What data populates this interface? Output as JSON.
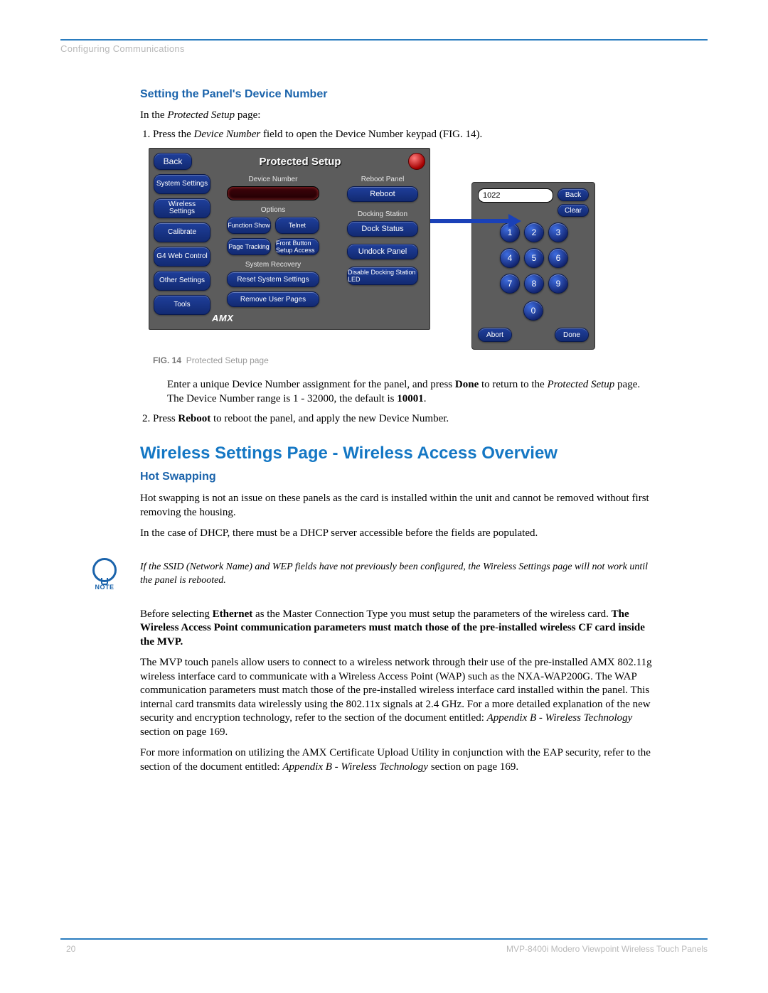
{
  "chapter_head": "Configuring Communications",
  "section_heading": "Setting the Panel's Device Number",
  "intro": {
    "prefix": "In the ",
    "em": "Protected Setup",
    "suffix": " page:"
  },
  "steps": {
    "s1": {
      "prefix": "Press the ",
      "em": "Device Number",
      "suffix": " field to open the Device Number keypad (FIG. 14)."
    },
    "s2": {
      "t1": "Enter a unique Device Number assignment for the panel",
      "comma": ",",
      "t2": " and press ",
      "bold1": "Done",
      "t3": " to return to the ",
      "em": "Protected Setup",
      "t4": " page. The Device Number range is 1 - 32000, the default is ",
      "bold2": "10001",
      "t5": "."
    },
    "s3": {
      "t1": "Press ",
      "bold": "Reboot",
      "t2": " to reboot the panel, and apply the new Device Number."
    }
  },
  "fig": {
    "label": "FIG. 14",
    "caption": "Protected Setup page"
  },
  "panel": {
    "back": "Back",
    "title": "Protected Setup",
    "side": [
      "System Settings",
      "Wireless Settings",
      "Calibrate",
      "G4 Web Control",
      "Other Settings",
      "Tools"
    ],
    "center": {
      "device_number_label": "Device Number",
      "options_label": "Options",
      "system_recovery_label": "System Recovery",
      "buttons": {
        "function_show": "Function Show",
        "telnet": "Telnet",
        "page_tracking": "Page Tracking",
        "front_button": "Front Button Setup Access",
        "reset_system": "Reset System Settings",
        "remove_user": "Remove User Pages"
      }
    },
    "right": {
      "reboot_panel_label": "Reboot Panel",
      "reboot": "Reboot",
      "docking_label": "Docking Station",
      "dock_status": "Dock Status",
      "undock_panel": "Undock Panel",
      "disable_docking": "Disable Docking Station LED"
    },
    "logo": "AMX"
  },
  "keypad": {
    "display_value": "1022",
    "back": "Back",
    "clear": "Clear",
    "keys": [
      "1",
      "2",
      "3",
      "4",
      "5",
      "6",
      "7",
      "8",
      "9",
      "0"
    ],
    "abort": "Abort",
    "done": "Done"
  },
  "main_heading": "Wireless Settings Page - Wireless Access Overview",
  "sub_heading": "Hot Swapping",
  "body": {
    "p1": "Hot swapping is not an issue on these panels as the card is installed within the unit and cannot be removed without first removing the housing.",
    "p2": "In the case of DHCP, there must be a DHCP server accessible before the fields are populated."
  },
  "note": {
    "label": "NOTE",
    "text": "If the SSID (Network Name) and WEP fields have not previously been configured, the Wireless Settings page will not work until the panel is rebooted."
  },
  "p3": {
    "t1": "Before selecting ",
    "b1": "Ethernet",
    "t2": " as the Master Connection Type you must setup the parameters of the wireless card. ",
    "b2": "The Wireless Access Point communication parameters must match those of the pre-installed wireless CF card inside the MVP."
  },
  "p4": {
    "t1": "The MVP touch panels allow users to connect to a wireless network through their use of the pre-installed AMX 802.11g wireless interface card to communicate with a Wireless Access Point (WAP) such as the NXA-WAP200G. The WAP communication parameters must match those of the pre-installed wireless interface card installed within the panel. This internal card transmits data wirelessly using the 802.11x signals at 2.4 GHz. For a more detailed explanation of the new security and encryption technology, refer to the section of the document entitled: ",
    "em": "Appendix B - Wireless Technology",
    "t2": " section on page 169."
  },
  "p5": {
    "t1": "For more information on utilizing the AMX Certificate Upload Utility in conjunction with the EAP security, refer to the section of the document entitled: ",
    "em": "Appendix B - Wireless Technology",
    "t2": " section on page 169."
  },
  "footer": {
    "page": "20",
    "doc": "MVP-8400i Modero Viewpoint Wireless Touch Panels"
  }
}
